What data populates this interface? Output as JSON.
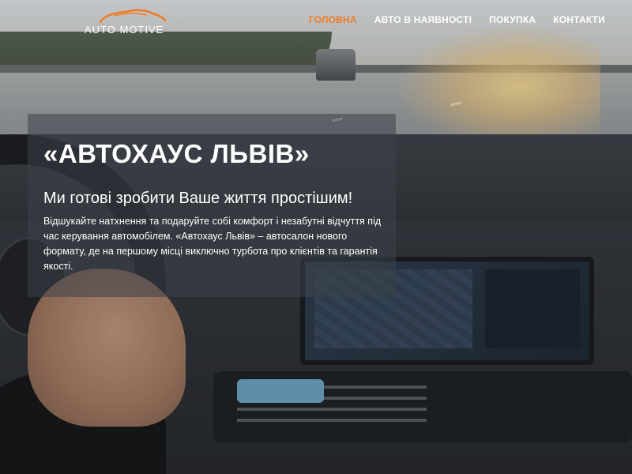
{
  "logo": {
    "text": "AUTO MOTIVE"
  },
  "nav": {
    "items": [
      {
        "label": "ГОЛОВНА",
        "active": true
      },
      {
        "label": "АВТО В НАЯВНОСТІ",
        "active": false
      },
      {
        "label": "ПОКУПКА",
        "active": false
      },
      {
        "label": "КОНТАКТИ",
        "active": false
      }
    ]
  },
  "hero": {
    "title": "«АВТОХАУС ЛЬВІВ»",
    "subtitle": "Ми готові зробити Ваше життя простішим!",
    "text": "Відшукайте натхнення та подаруйте собі комфорт і незабутні відчуття під час керування автомобілем. «Автохаус Львів» – автосалон нового формату, де на першому місці виключно турбота про клієнтів та гарантія якості."
  },
  "colors": {
    "accent": "#f07a22",
    "nav_text": "#ffffff",
    "hero_panel": "rgba(60,66,74,0.55)"
  },
  "icons": {
    "logo_mark": "car-silhouette-icon"
  }
}
